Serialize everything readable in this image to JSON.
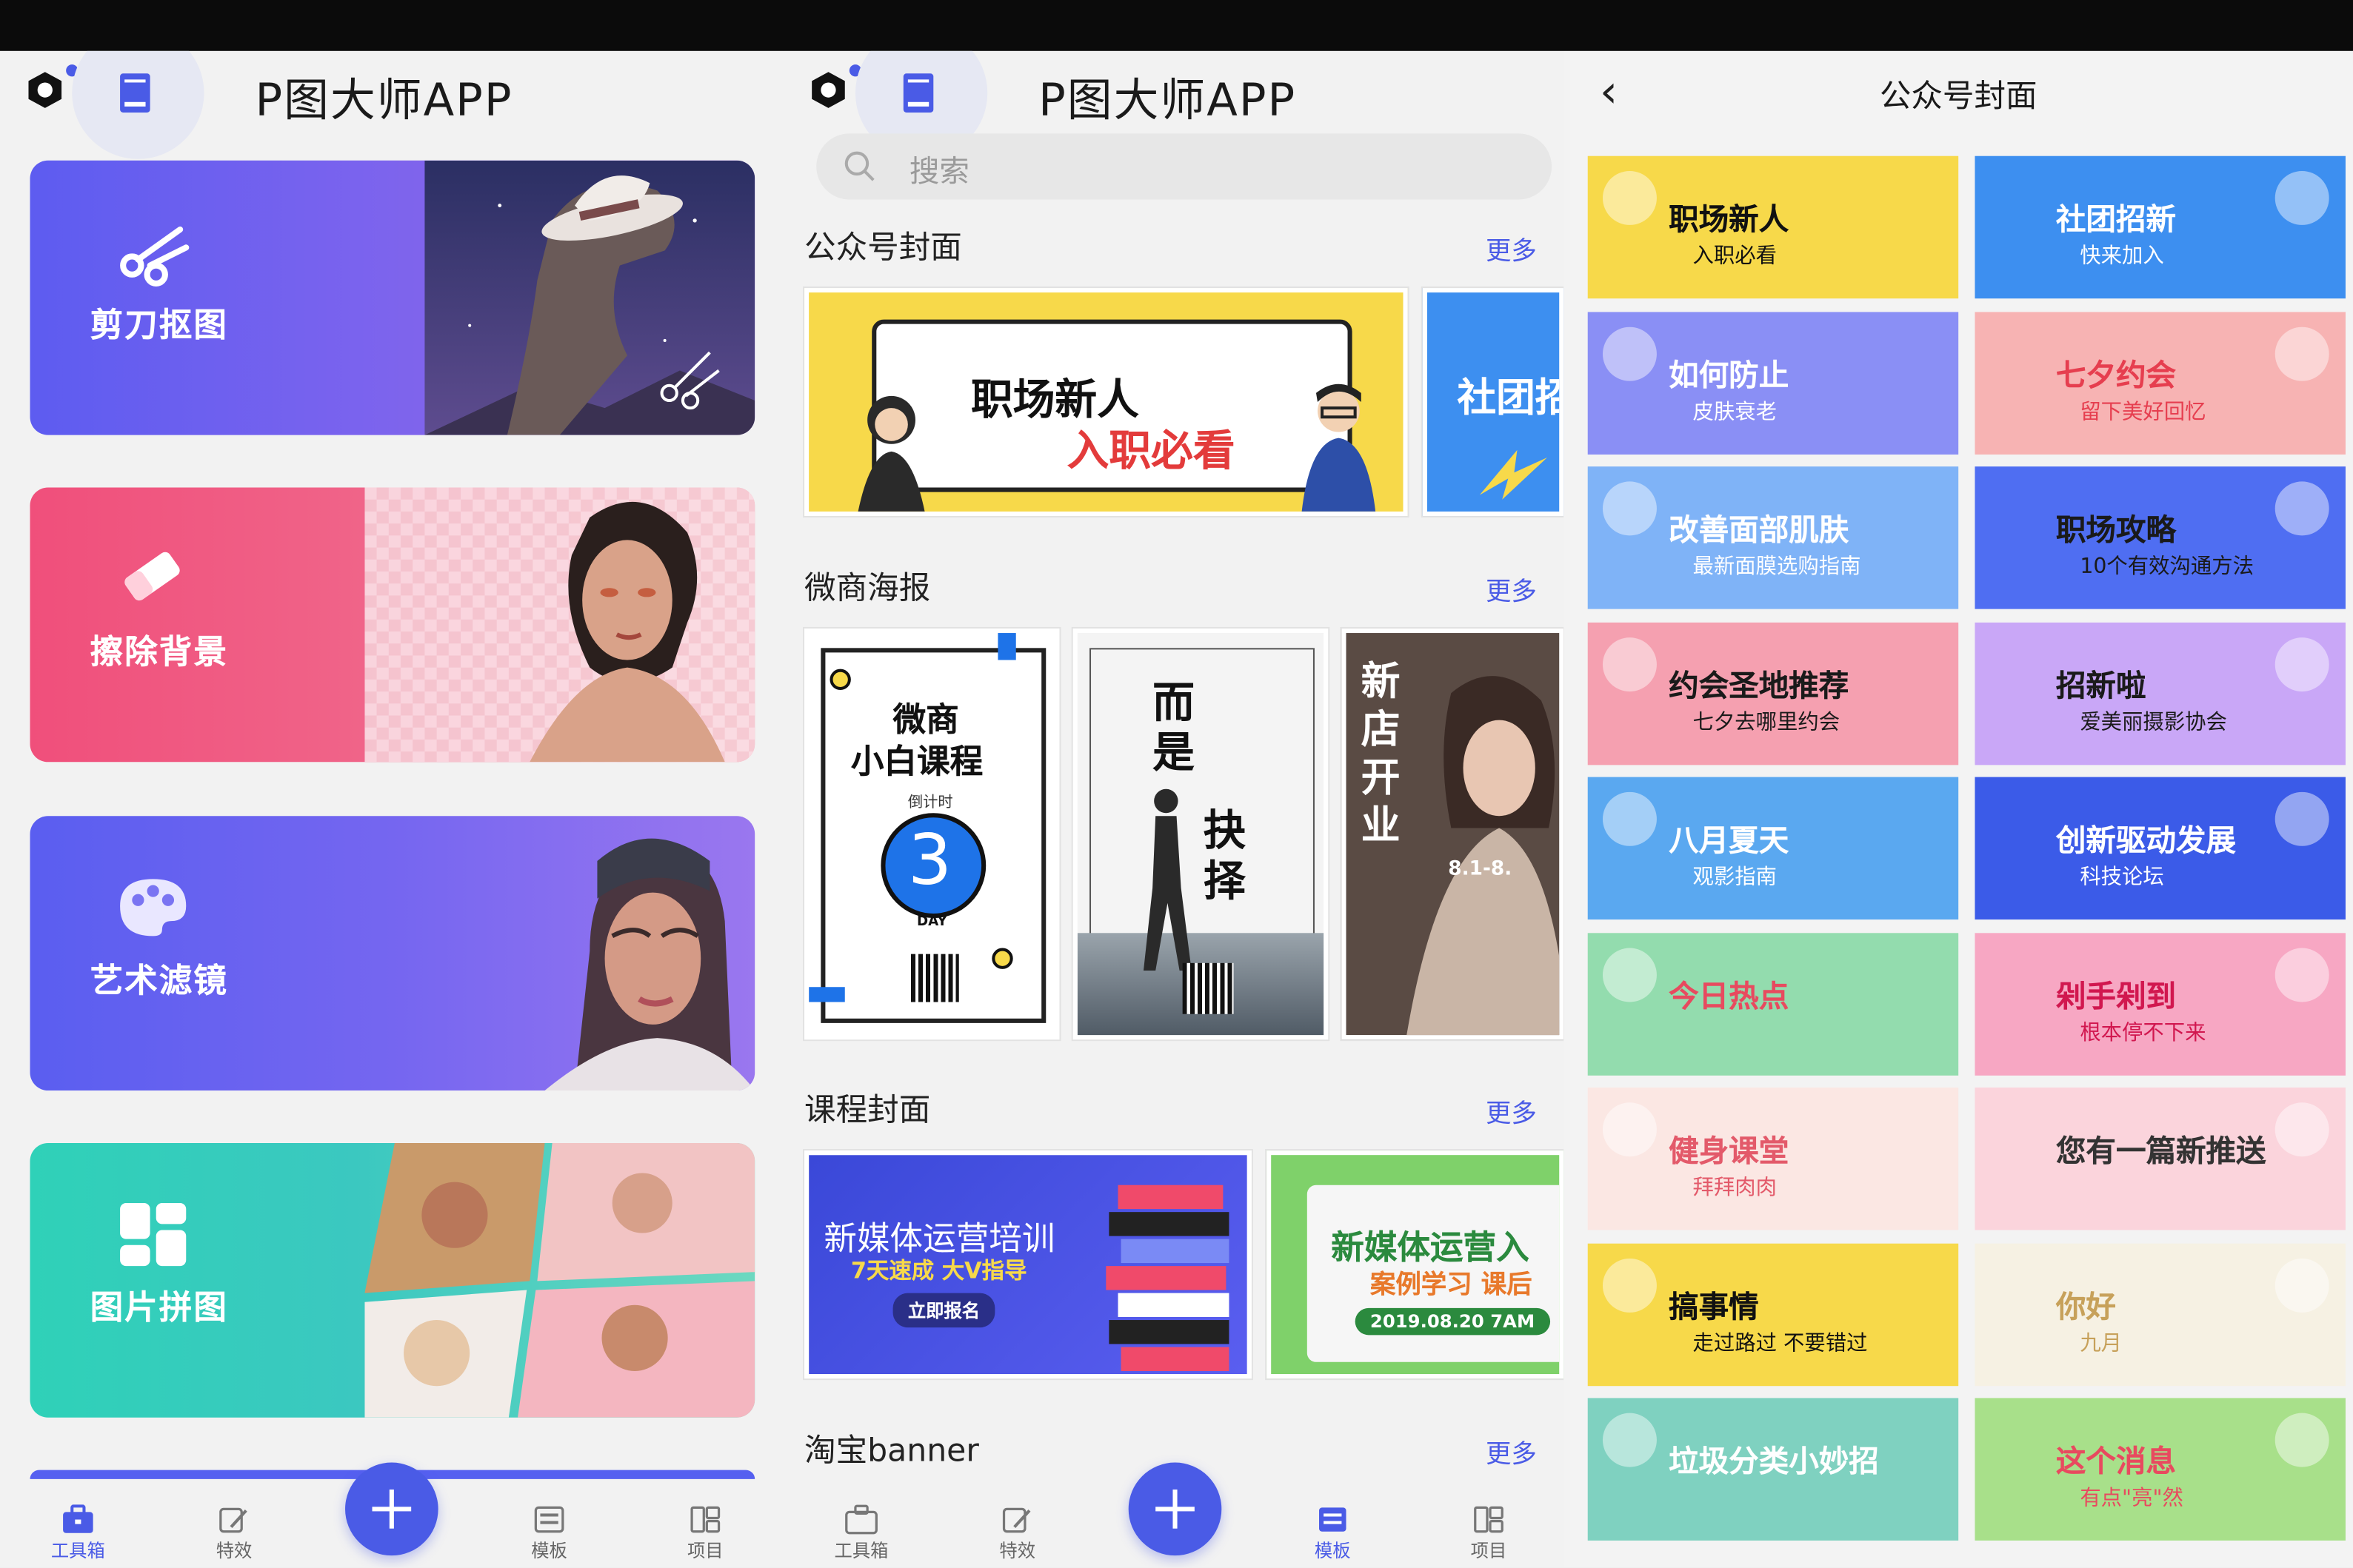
{
  "screen1": {
    "title": "P图大师APP",
    "tools": [
      {
        "label": "剪刀抠图"
      },
      {
        "label": "擦除背景"
      },
      {
        "label": "艺术滤镜"
      },
      {
        "label": "图片拼图"
      }
    ],
    "tabs": [
      "工具箱",
      "特效",
      "模板",
      "项目"
    ],
    "active_tab": "工具箱"
  },
  "screen2": {
    "title": "P图大师APP",
    "search_placeholder": "搜索",
    "sections": [
      {
        "title": "公众号封面",
        "more": "更多"
      },
      {
        "title": "微商海报",
        "more": "更多"
      },
      {
        "title": "课程封面",
        "more": "更多"
      },
      {
        "title": "淘宝banner",
        "more": "更多"
      }
    ],
    "cover1": {
      "line1": "职场新人",
      "line2": "入职必看"
    },
    "cover2": {
      "text": "社团招"
    },
    "poster1": {
      "line1": "微商",
      "line2": "小白课程",
      "countdown_label": "倒计时",
      "number": "3",
      "day": "DAY"
    },
    "poster2": {
      "line1": "而",
      "line2": "是",
      "line3": "抉",
      "line4": "择"
    },
    "poster3": {
      "line1": "新",
      "line2": "店",
      "line3": "开",
      "line4": "业",
      "date": "8.1-8."
    },
    "course1": {
      "title": "新媒体运营培训",
      "subtitle": "7天速成 大V指导",
      "button": "立即报名"
    },
    "course2": {
      "title": "新媒体运营入",
      "subtitle": "案例学习 课后",
      "date": "2019.08.20 7AM"
    },
    "tabs": [
      "工具箱",
      "特效",
      "模板",
      "项目"
    ],
    "active_tab": "模板"
  },
  "screen3": {
    "back": "‹",
    "title": "公众号封面",
    "cards": [
      {
        "text": "职场新人",
        "text2": "入职必看",
        "bg": "#f7d94a",
        "fg": "#111111"
      },
      {
        "text": "社团招新",
        "text2": "快来加入",
        "bg": "#3d8ff0",
        "fg": "#ffffff"
      },
      {
        "text": "如何防止",
        "text2": "皮肤衰老",
        "bg": "#8a8ff5",
        "fg": "#ffffff"
      },
      {
        "text": "七夕约会",
        "text2": "留下美好回忆",
        "bg": "#f7b3b3",
        "fg": "#e63e4f"
      },
      {
        "text": "改善面部肌肤",
        "text2": "最新面膜选购指南",
        "bg": "#7fb3f7",
        "fg": "#ffffff"
      },
      {
        "text": "职场攻略",
        "text2": "10个有效沟通方法",
        "bg": "#4f6ef2",
        "fg": "#1a1a1a"
      },
      {
        "text": "约会圣地推荐",
        "text2": "七夕去哪里约会",
        "bg": "#f5a0b0",
        "fg": "#1a1a1a"
      },
      {
        "text": "招新啦",
        "text2": "爱美丽摄影协会",
        "bg": "#c9a7f7",
        "fg": "#1a1a1a"
      },
      {
        "text": "八月夏天",
        "text2": "观影指南",
        "bg": "#5aa8f0",
        "fg": "#ffffff"
      },
      {
        "text": "创新驱动发展",
        "text2": "科技论坛",
        "bg": "#3b5be8",
        "fg": "#ffffff"
      },
      {
        "text": "今日热点",
        "text2": "",
        "bg": "#93dcae",
        "fg": "#e84a5f"
      },
      {
        "text": "剁手剁到",
        "text2": "根本停不下来",
        "bg": "#f7a7c3",
        "fg": "#d1174f"
      },
      {
        "text": "健身课堂",
        "text2": "拜拜肉肉",
        "bg": "#fbe7e3",
        "fg": "#e35a6a"
      },
      {
        "text": "您有一篇新推送",
        "text2": "",
        "bg": "#fbd4dc",
        "fg": "#333333"
      },
      {
        "text": "搞事情",
        "text2": "走过路过 不要错过",
        "bg": "#f7d94a",
        "fg": "#111111"
      },
      {
        "text": "你好",
        "text2": "九月",
        "bg": "#f6f1e3",
        "fg": "#c7a15a"
      },
      {
        "text": "垃圾分类小妙招",
        "text2": "",
        "bg": "#7fd1c0",
        "fg": "#ffffff"
      },
      {
        "text": "这个消息",
        "text2": "有点\"亮\"然",
        "bg": "#a8e08a",
        "fg": "#e84a5f"
      }
    ]
  }
}
